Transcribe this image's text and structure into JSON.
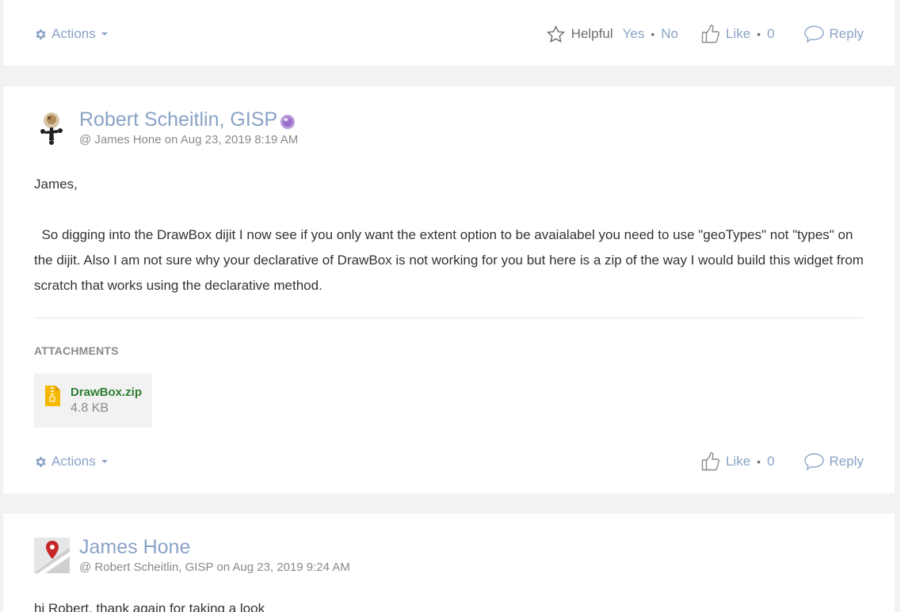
{
  "post1": {
    "actions_label": "Actions",
    "helpful_label": "Helpful",
    "yes_label": "Yes",
    "dot": "•",
    "no_label": "No",
    "like_label": "Like",
    "like_count": "0",
    "reply_label": "Reply"
  },
  "post2": {
    "author": "Robert Scheitlin, GISP",
    "meta": "@ James Hone on Aug 23, 2019 8:19 AM",
    "greeting": "James,",
    "body": "  So digging into the DrawBox dijit I now see if you only want the extent option to be avaialabel you need to use \"geoTypes\" not \"types\" on the dijit. Also I am not sure why your declarative of DrawBox is not working for you but here is a zip of the way I would build this widget from scratch that works using the declarative method.",
    "attachments_title": "ATTACHMENTS",
    "attachment": {
      "name": "DrawBox.zip",
      "size": "4.8 KB"
    },
    "actions_label": "Actions",
    "like_label": "Like",
    "dot": "•",
    "like_count": "0",
    "reply_label": "Reply"
  },
  "post3": {
    "author": "James Hone",
    "meta": "@ Robert Scheitlin, GISP on Aug 23, 2019 9:24 AM",
    "body_partial": "hi Robert, thank again for taking a look"
  },
  "colors": {
    "link": "#8aa3c6",
    "attachment": "#2e7d32",
    "zip": "#f5b800",
    "pin": "#c62828"
  }
}
